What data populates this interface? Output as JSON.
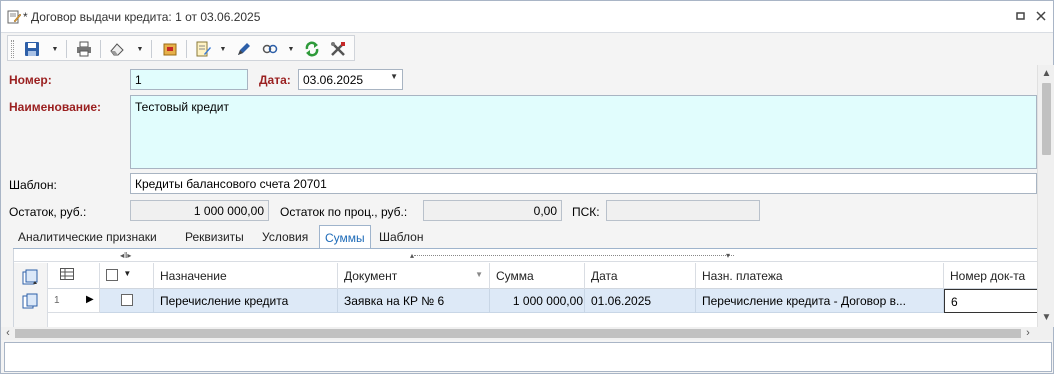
{
  "window": {
    "title": "* Договор выдачи кредита: 1 от 03.06.2025"
  },
  "toolbar": {
    "icons": [
      "save-icon",
      "print-icon",
      "eraser-icon",
      "archive-icon",
      "document-edit-icon",
      "pen-icon",
      "link-icon",
      "refresh-icon",
      "tools-icon"
    ]
  },
  "form": {
    "number_label": "Номер:",
    "number_value": "1",
    "date_label": "Дата:",
    "date_value": "03.06.2025",
    "name_label": "Наименование:",
    "name_value": "Тестовый кредит",
    "template_label": "Шаблон:",
    "template_value": "Кредиты балансового счета 20701",
    "balance_label": "Остаток, руб.:",
    "balance_value": "1 000 000,00",
    "interest_balance_label": "Остаток по проц., руб.:",
    "interest_balance_value": "0,00",
    "psk_label": "ПСК:",
    "psk_value": ""
  },
  "tabs": [
    {
      "label": "Аналитические признаки",
      "active": false
    },
    {
      "label": "Реквизиты",
      "active": false
    },
    {
      "label": "Условия",
      "active": false
    },
    {
      "label": "Суммы",
      "active": true
    },
    {
      "label": "Шаблон",
      "active": false
    }
  ],
  "grid": {
    "columns": [
      "Назначение",
      "Документ",
      "Сумма",
      "Дата",
      "Назн. платежа",
      "Номер док-та"
    ],
    "rows": [
      {
        "index": "1",
        "purpose": "Перечисление кредита",
        "document": "Заявка на КР № 6",
        "amount": "1 000 000,00",
        "date": "01.06.2025",
        "payment_purpose": "Перечисление кредита - Договор в...",
        "doc_number": "6"
      }
    ]
  },
  "colors": {
    "required_label": "#9a1f1f",
    "cyan_field": "#e1fdfd",
    "selected_row": "#dde9f7",
    "active_tab": "#1e6bb8"
  }
}
